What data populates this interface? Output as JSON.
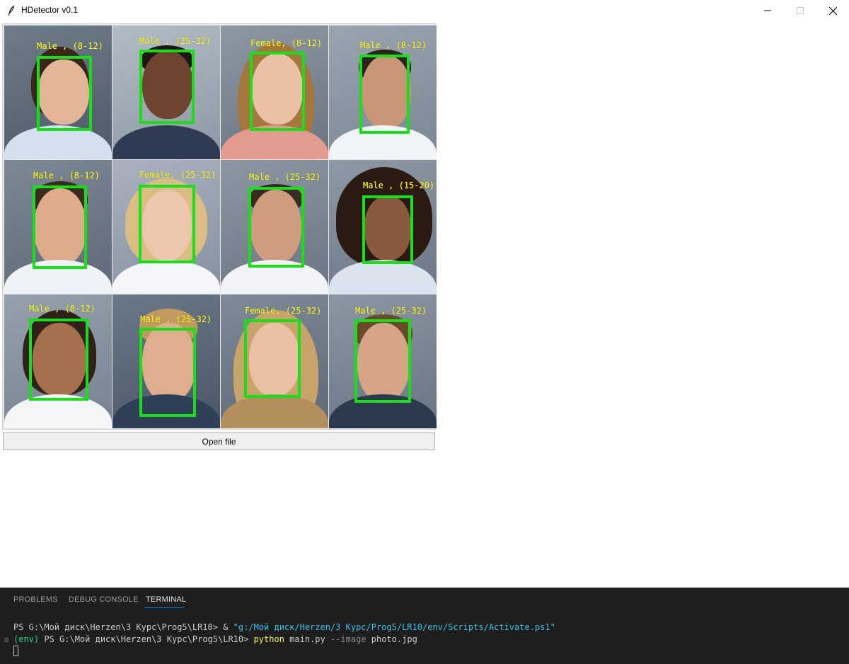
{
  "window": {
    "title": "HDetector v0.1",
    "icon": "feather-icon",
    "controls": [
      "minimize-icon",
      "maximize-icon",
      "close-icon"
    ]
  },
  "detections": [
    {
      "label": "Male , (8-12)"
    },
    {
      "label": "Male , (25-32)"
    },
    {
      "label": "Female, (8-12)"
    },
    {
      "label": "Male , (8-12)"
    },
    {
      "label": "Male , (8-12)"
    },
    {
      "label": "Female, (25-32)"
    },
    {
      "label": "Male , (25-32)"
    },
    {
      "label": "Male , (15-20)"
    },
    {
      "label": "Male , (8-12)"
    },
    {
      "label": "Male , (25-32)"
    },
    {
      "label": "Female, (25-32)"
    },
    {
      "label": "Male , (25-32)"
    }
  ],
  "open_button": {
    "label": "Open file"
  },
  "panel": {
    "tabs": [
      {
        "label": "PROBLEMS",
        "active": false
      },
      {
        "label": "DEBUG CONSOLE",
        "active": false
      },
      {
        "label": "TERMINAL",
        "active": true
      }
    ],
    "terminal": {
      "line1_prompt": "PS G:\\Мой диск\\Herzen\\3 Курс\\Prog5\\LR10> ",
      "line1_op": "& ",
      "line1_path": "\"g:/Мой диск/Herzen/3 Курс/Prog5/LR10/env/Scripts/Activate.ps1\"",
      "line2_env": "(env) ",
      "line2_prompt": "PS G:\\Мой диск\\Herzen\\3 Курс\\Prog5\\LR10> ",
      "line2_cmd": "python",
      "line2_arg1": " main.py ",
      "line2_flag": "--image",
      "line2_arg2": " photo.jpg"
    }
  },
  "colors": {
    "box": "#17e017",
    "label": "#ffff33",
    "terminal_bg": "#1e1e1e",
    "accent": "#0078d4"
  }
}
